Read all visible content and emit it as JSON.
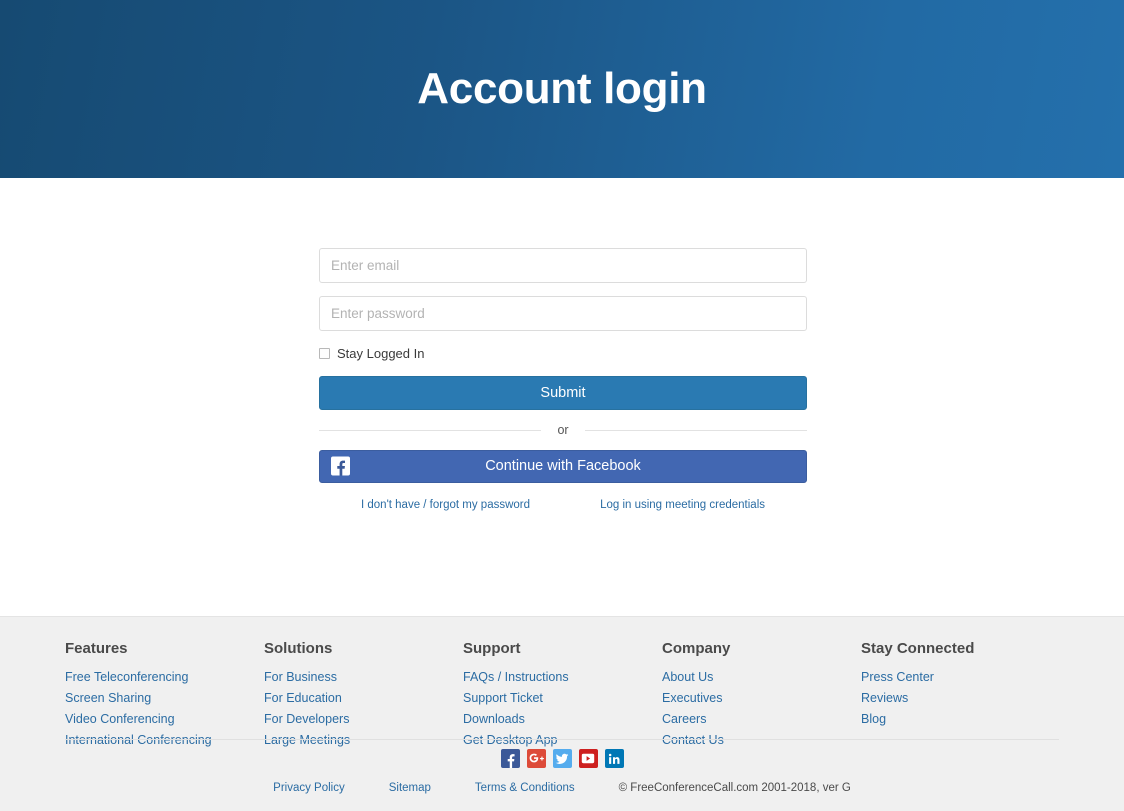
{
  "hero": {
    "title": "Account login",
    "gradient_from": "#164a72",
    "gradient_to": "#2470ac"
  },
  "login_form": {
    "email": {
      "value": "",
      "placeholder": "Enter email"
    },
    "password": {
      "value": "",
      "placeholder": "Enter password"
    },
    "stay_logged_in": {
      "label": "Stay Logged In",
      "checked": false
    },
    "submit_label": "Submit",
    "divider_text": "or",
    "facebook_label": "Continue with Facebook",
    "facebook_icon": "facebook-icon",
    "facebook_color": "#4267b2",
    "submit_color": "#2a7ab2",
    "links": [
      {
        "label": "I don't have / forgot my password",
        "name": "forgot-password-link"
      },
      {
        "label": "Log in using meeting credentials",
        "name": "meeting-credentials-link"
      }
    ],
    "link_color": "#2b6ca3"
  },
  "footer": {
    "columns": [
      {
        "title": "Features",
        "links": [
          "Free Teleconferencing",
          "Screen Sharing",
          "Video Conferencing",
          "International Conferencing"
        ]
      },
      {
        "title": "Solutions",
        "links": [
          "For Business",
          "For Education",
          "For Developers",
          "Large Meetings"
        ]
      },
      {
        "title": "Support",
        "links": [
          "FAQs / Instructions",
          "Support Ticket",
          "Downloads",
          "Get Desktop App"
        ]
      },
      {
        "title": "Company",
        "links": [
          "About Us",
          "Executives",
          "Careers",
          "Contact Us"
        ]
      },
      {
        "title": "Stay Connected",
        "links": [
          "Press Center",
          "Reviews",
          "Blog"
        ]
      }
    ],
    "social": [
      {
        "name": "facebook-icon",
        "color": "#3b5998"
      },
      {
        "name": "google-plus-icon",
        "color": "#dd4b39"
      },
      {
        "name": "twitter-icon",
        "color": "#55acee"
      },
      {
        "name": "youtube-icon",
        "color": "#cd201f"
      },
      {
        "name": "linkedin-icon",
        "color": "#0077b5"
      }
    ],
    "bottom_links": [
      "Privacy Policy",
      "Sitemap",
      "Terms & Conditions"
    ],
    "copyright": "© FreeConferenceCall.com 2001-2018, ver G",
    "background": "#f0f0f0"
  }
}
